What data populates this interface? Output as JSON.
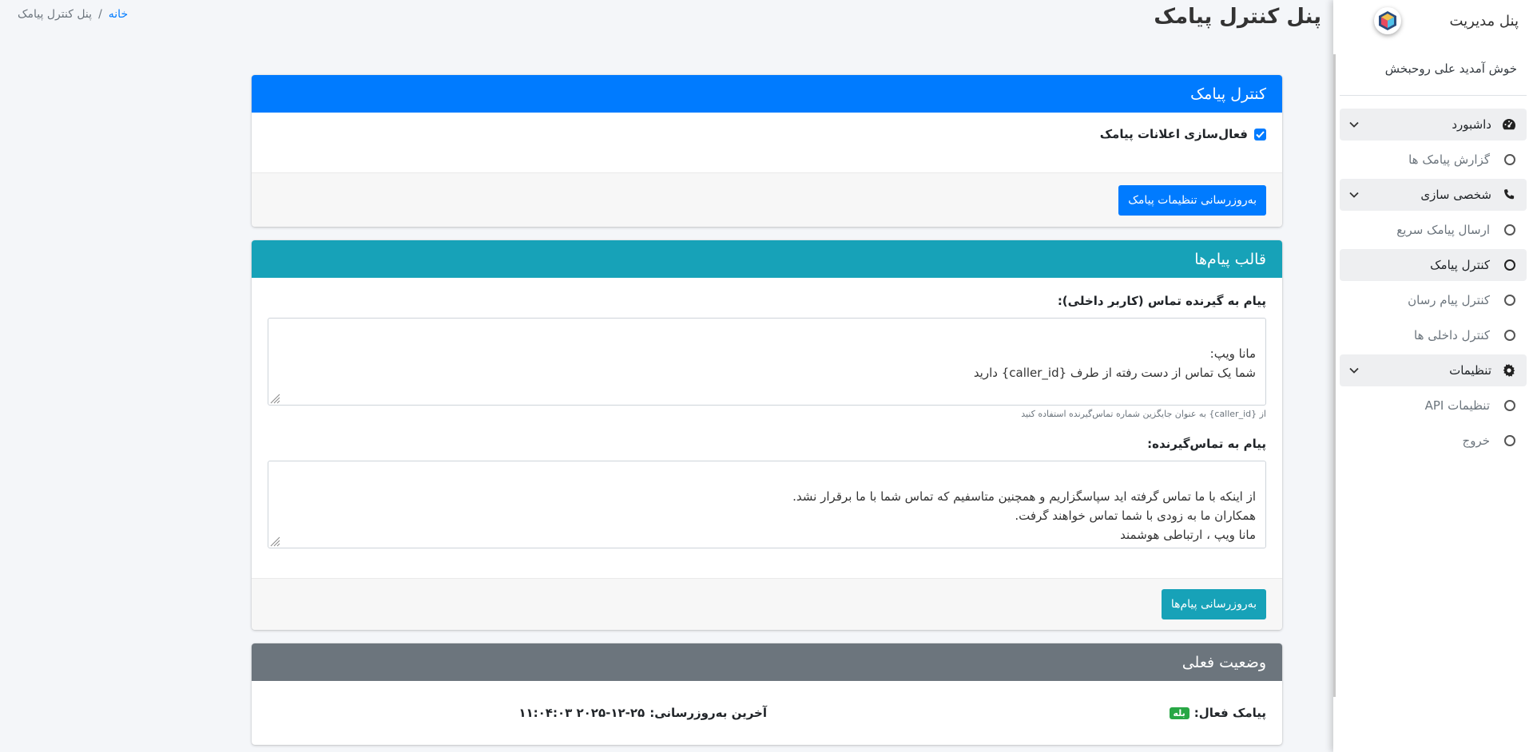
{
  "sidebar": {
    "brand": "پنل مدیریت",
    "welcome": "خوش آمدید علی روحبخش",
    "groups": [
      {
        "label": "داشبورد",
        "icon": "dashboard-icon",
        "items": [
          {
            "label": "گزارش پیامک ها"
          }
        ]
      },
      {
        "label": "شخصی سازی",
        "icon": "phone-icon",
        "items": [
          {
            "label": "ارسال پیامک سریع"
          },
          {
            "label": "کنترل پیامک",
            "active": true
          },
          {
            "label": "کنترل پیام رسان"
          },
          {
            "label": "کنترل داخلی ها"
          }
        ]
      },
      {
        "label": "تنظیمات",
        "icon": "gear-icon",
        "items": [
          {
            "label": "تنظیمات API"
          },
          {
            "label": "خروج"
          }
        ]
      }
    ]
  },
  "header": {
    "title": "پنل کنترل پیامک",
    "breadcrumb": {
      "home": "خانه",
      "separator": "/",
      "current": "پنل کنترل پیامک"
    }
  },
  "sms_card": {
    "title": "کنترل پیامک",
    "header_color": "#007bff",
    "checkbox_label": "فعال‌سازی اعلانات پیامک",
    "checked": true,
    "button": "به‌روزرسانی تنظیمات پیامک"
  },
  "template_card": {
    "title": "قالب پیام‌ها",
    "header_color": "#17a2b8",
    "field1_label": "پیام به گیرنده تماس (کاربر داخلی):",
    "field1_value": "مانا ویپ:\nشما یک تماس از دست رفته از طرف {caller_id} دارید",
    "field1_help": "از {caller_id} به عنوان جایگزین شماره تماس‌گیرنده استفاده کنید",
    "field2_label": "پیام به تماس‌گیرنده:",
    "field2_value": "از اینکه با ما تماس گرفته اید سپاسگزاریم و همچنین متاسفیم که تماس شما با ما برقرار نشد.\nهمکاران ما به زودی با شما تماس خواهند گرفت.\nمانا ویپ ، ارتباطی هوشمند",
    "button": "به‌روزرسانی پیام‌ها"
  },
  "status_card": {
    "title": "وضعیت فعلی",
    "header_color": "#6c757d",
    "sms_active_label": "پیامک فعال:",
    "sms_active_value": "بله",
    "last_update_label": "آخرین به‌روزرسانی:",
    "last_update_value": "۲۰۲۵-۱۲-۲۵ ۱۱:۰۴:۰۳"
  }
}
